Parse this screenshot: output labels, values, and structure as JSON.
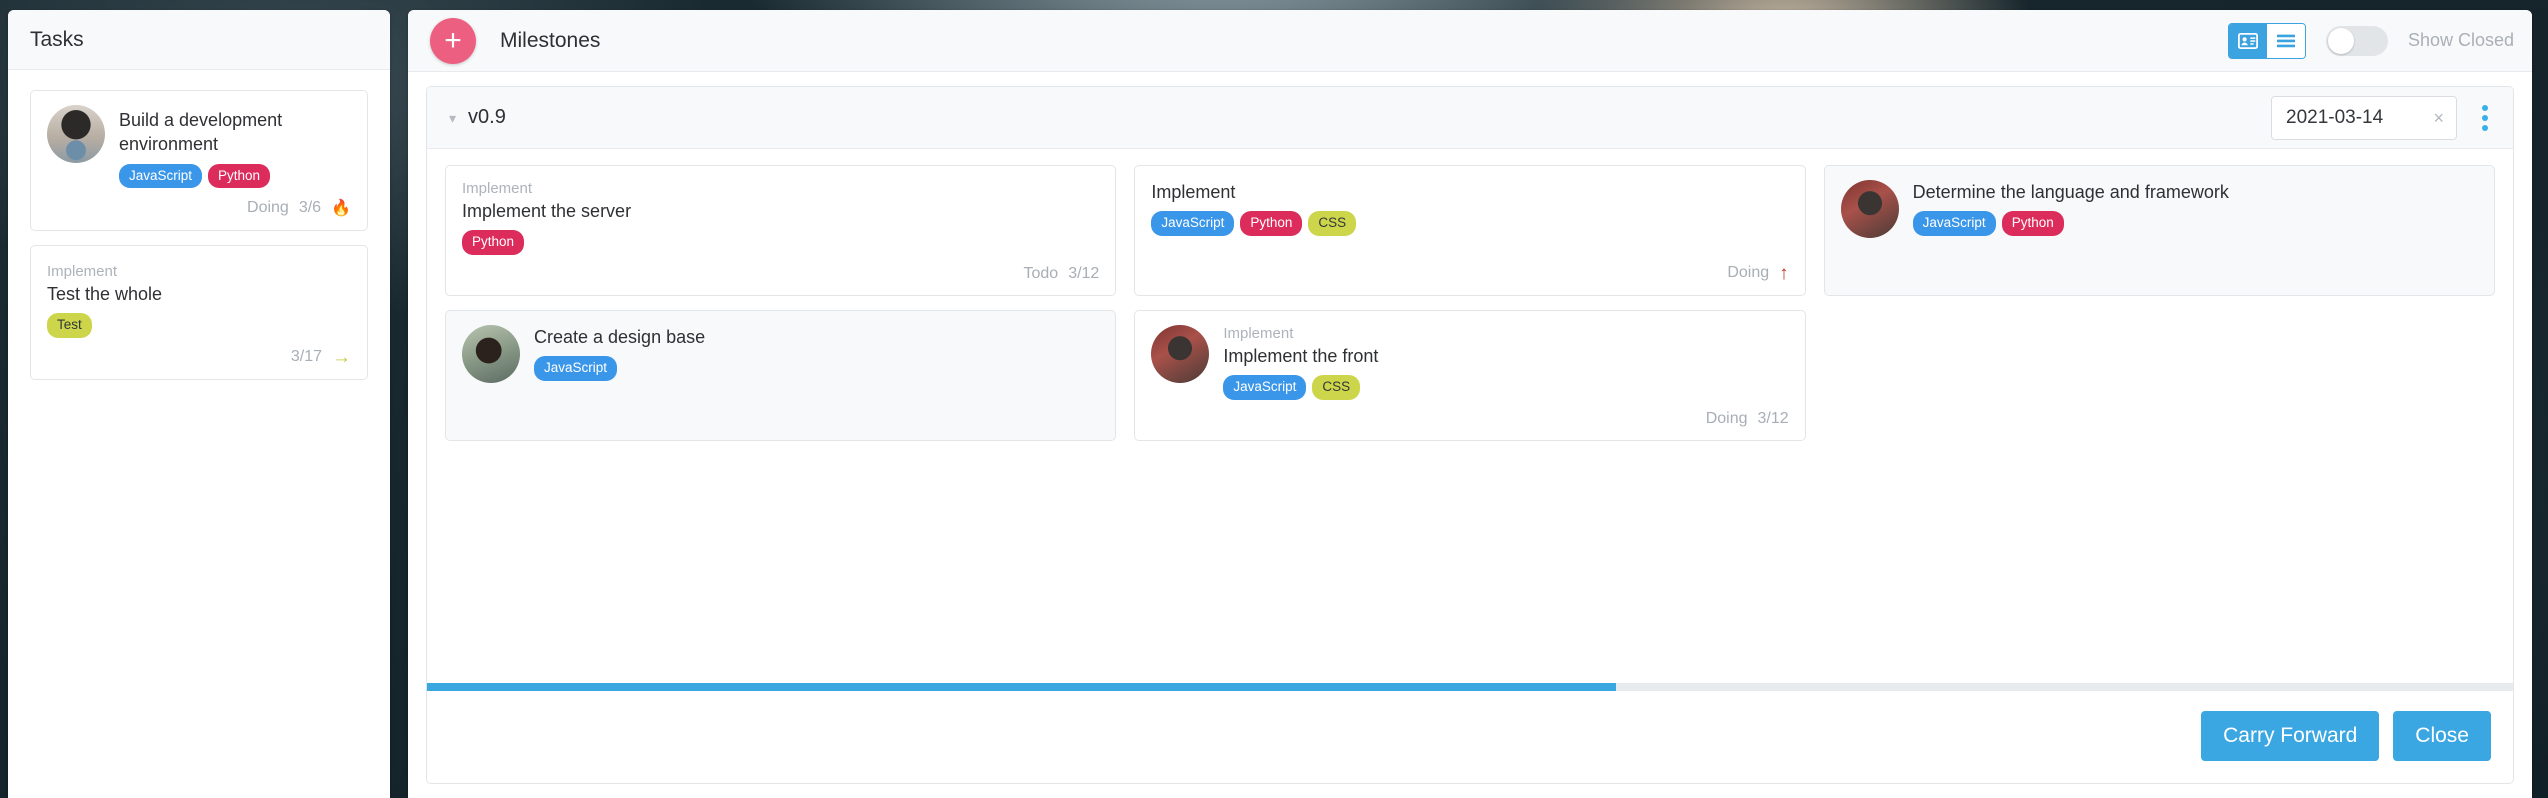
{
  "tasks_panel": {
    "title": "Tasks",
    "cards": [
      {
        "parent": "",
        "name": "Build a development environment",
        "avatar": "av1",
        "tags": [
          {
            "label": "JavaScript",
            "cls": "js"
          },
          {
            "label": "Python",
            "cls": "py"
          }
        ],
        "status": "Doing",
        "count": "3/6",
        "icon": "fire-icon"
      },
      {
        "parent": "Implement",
        "name": "Test the whole",
        "avatar": "",
        "tags": [
          {
            "label": "Test",
            "cls": "test"
          }
        ],
        "status": "",
        "count": "3/17",
        "icon": "arrow-right-icon"
      }
    ]
  },
  "milestones_panel": {
    "add_label": "+",
    "title": "Milestones",
    "view_toggle": {
      "card_icon": "contact-card-icon",
      "list_icon": "list-icon",
      "active": "list"
    },
    "show_closed_label": "Show Closed",
    "show_closed_on": false,
    "milestone": {
      "chevron": "chevron-down-icon",
      "version": "v0.9",
      "date_value": "2021-03-14",
      "date_clear_icon": "close-icon",
      "menu_icon": "kebab-menu-icon",
      "progress_percent": 57,
      "items": [
        {
          "parent": "Implement",
          "name": "Implement the server",
          "avatar": "",
          "shade": false,
          "tags": [
            {
              "label": "Python",
              "cls": "py"
            }
          ],
          "status": "Todo",
          "count": "3/12",
          "icon": ""
        },
        {
          "parent": "",
          "name": "Implement",
          "avatar": "",
          "shade": false,
          "tags": [
            {
              "label": "JavaScript",
              "cls": "js"
            },
            {
              "label": "Python",
              "cls": "py"
            },
            {
              "label": "CSS",
              "cls": "css"
            }
          ],
          "status": "Doing",
          "count": "",
          "icon": "arrow-up-icon"
        },
        {
          "parent": "",
          "name": "Determine the language and framework",
          "avatar": "av2",
          "shade": true,
          "tags": [
            {
              "label": "JavaScript",
              "cls": "js"
            },
            {
              "label": "Python",
              "cls": "py"
            }
          ],
          "status": "",
          "count": "",
          "icon": ""
        },
        {
          "parent": "",
          "name": "Create a design base",
          "avatar": "av3",
          "shade": true,
          "tags": [
            {
              "label": "JavaScript",
              "cls": "js"
            }
          ],
          "status": "",
          "count": "",
          "icon": ""
        },
        {
          "parent": "Implement",
          "name": "Implement the front",
          "avatar": "av2",
          "shade": false,
          "tags": [
            {
              "label": "JavaScript",
              "cls": "js"
            },
            {
              "label": "CSS",
              "cls": "css"
            }
          ],
          "status": "Doing",
          "count": "3/12",
          "icon": ""
        }
      ]
    },
    "actions": [
      {
        "label": "Carry Forward",
        "name": "carry-forward-button"
      },
      {
        "label": "Close",
        "name": "close-milestone-button"
      }
    ]
  },
  "colors": {
    "accent_blue": "#3aa6e2",
    "accent_pink": "#ec5f81",
    "tag_js": "#3a96e8",
    "tag_py": "#dc2c5c",
    "tag_css": "#cdd64a"
  }
}
